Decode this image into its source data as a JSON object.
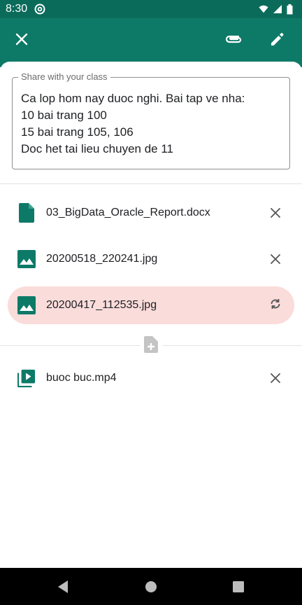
{
  "status_bar": {
    "time": "8:30",
    "icons": [
      "at-sign-icon",
      "wifi-icon",
      "signal-icon",
      "battery-icon"
    ]
  },
  "app_bar": {
    "close_icon": "close-icon",
    "attach_icon": "paperclip-icon",
    "edit_icon": "pencil-icon",
    "background_color": "#0d7a67"
  },
  "message": {
    "label": "Share with your class",
    "text": "Ca lop hom nay duoc nghi. Bai tap ve nha:\n10 bai trang 100\n15 bai trang 105, 106\nDoc het tai lieu chuyen de 11"
  },
  "attachments": [
    {
      "name": "03_BigData_Oracle_Report.docx",
      "icon": "document-icon",
      "action": "remove",
      "status": "ok"
    },
    {
      "name": "20200518_220241.jpg",
      "icon": "image-icon",
      "action": "remove",
      "status": "ok"
    },
    {
      "name": "20200417_112535.jpg",
      "icon": "image-icon",
      "action": "retry",
      "status": "error"
    },
    {
      "name": "buoc buc.mp4",
      "icon": "video-library-icon",
      "action": "remove",
      "status": "ok"
    }
  ],
  "colors": {
    "accent": "#0d7a67",
    "error_background": "#fadcdb"
  }
}
